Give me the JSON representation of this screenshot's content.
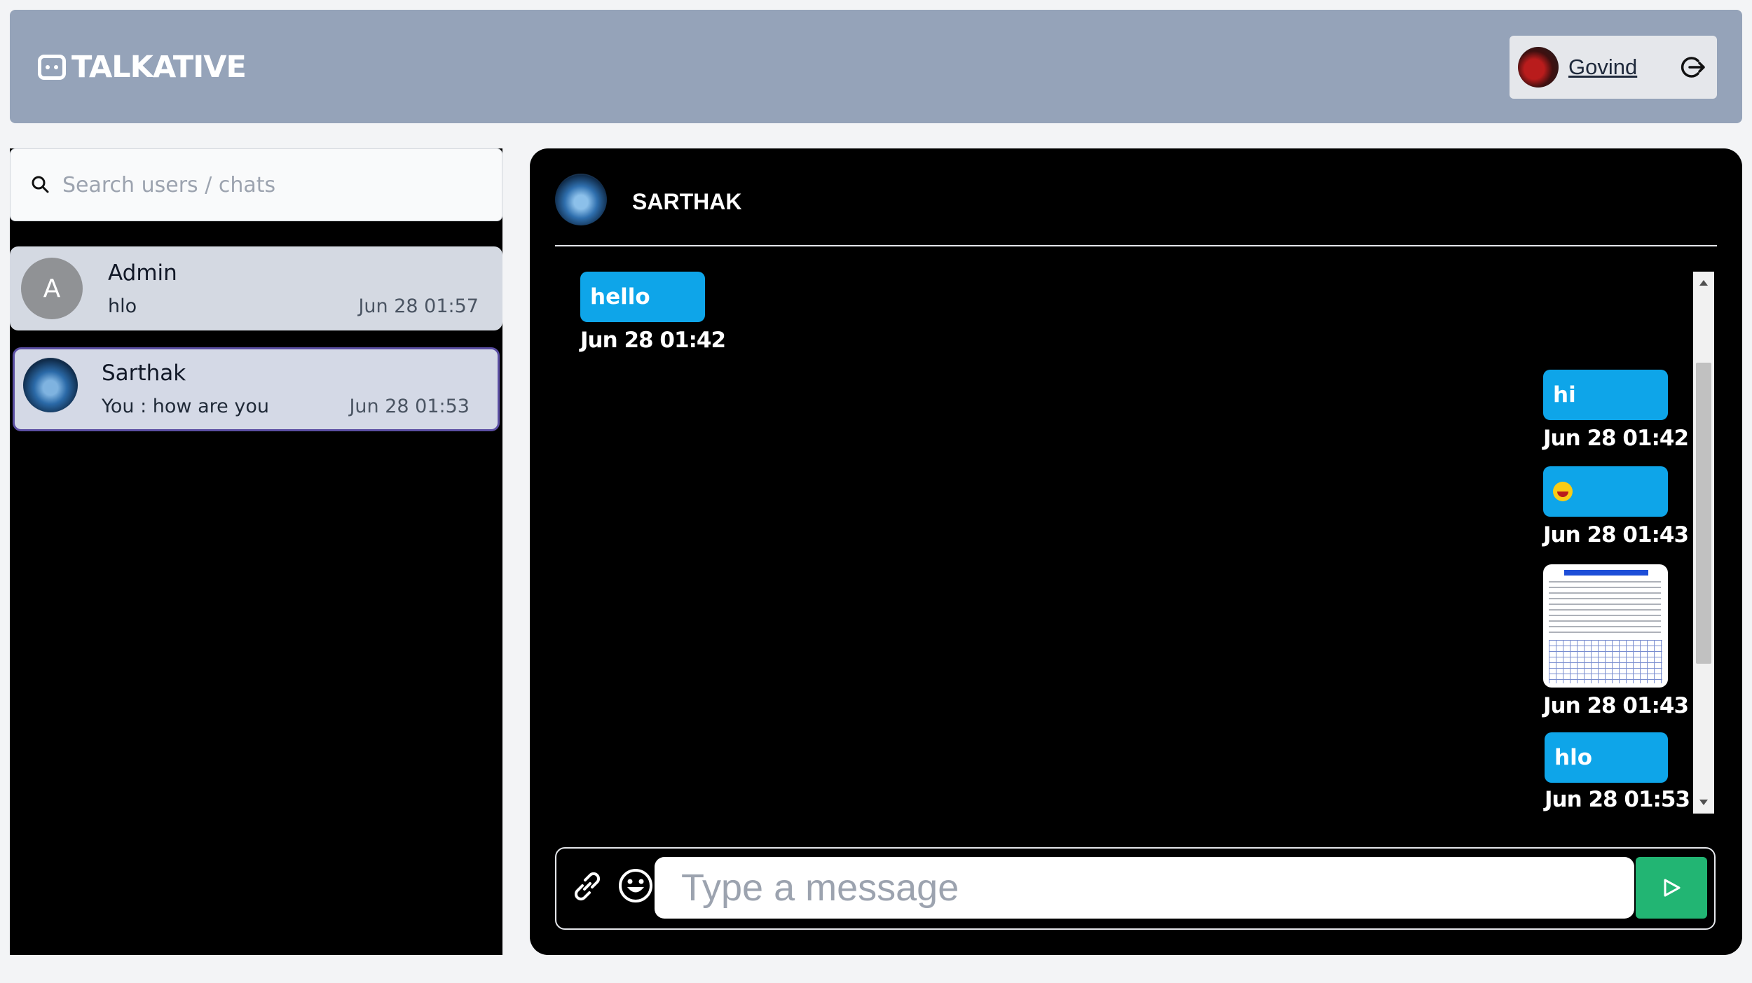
{
  "header": {
    "brand": "TALKATIVE",
    "user_name": "Govind"
  },
  "sidebar": {
    "search_placeholder": "Search users / chats",
    "chats": [
      {
        "avatar_letter": "A",
        "name": "Admin",
        "last": "hlo",
        "time": "Jun 28 01:57"
      },
      {
        "name": "Sarthak",
        "last": "You : how are you",
        "time": "Jun 28 01:53"
      }
    ]
  },
  "conversation": {
    "title": "SARTHAK",
    "messages": [
      {
        "side": "left",
        "text": "hello",
        "time": "Jun 28 01:42"
      },
      {
        "side": "right",
        "text": "hi",
        "time": "Jun 28 01:42"
      },
      {
        "side": "right",
        "type": "emoji",
        "emoji": "grinning-face",
        "time": "Jun 28 01:43"
      },
      {
        "side": "right",
        "type": "image",
        "image_caption": "Memory Interfacing in 8086",
        "time": "Jun 28 01:43"
      },
      {
        "side": "right",
        "text": "hlo",
        "time": "Jun 28 01:53"
      }
    ],
    "composer_placeholder": "Type a message"
  },
  "colors": {
    "header_bg": "#95a3b9",
    "bubble": "#0ea5e9",
    "send_button": "#22b573",
    "active_chat_border": "#5b4fa3"
  },
  "icons": [
    "chat-icon",
    "logout-icon",
    "search-icon",
    "link-icon",
    "emoji-icon",
    "send-icon"
  ]
}
